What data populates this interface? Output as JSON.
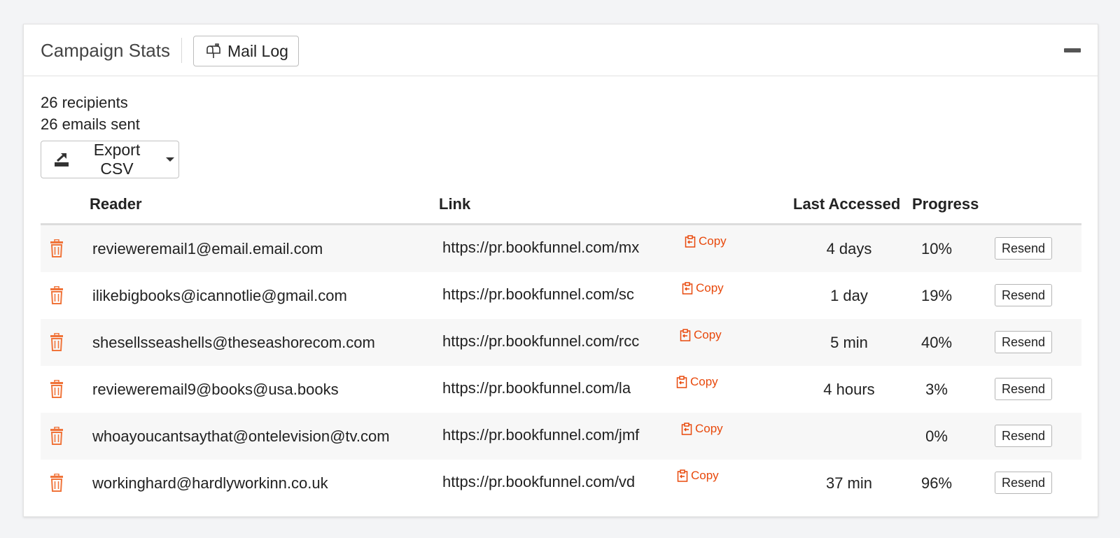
{
  "header": {
    "title": "Campaign Stats",
    "mail_log_label": "Mail Log"
  },
  "summary": {
    "recipients": "26 recipients",
    "emails_sent": "26 emails sent"
  },
  "export": {
    "label": "Export CSV"
  },
  "table": {
    "columns": [
      "Reader",
      "Link",
      "Last Accessed",
      "Progress"
    ],
    "copy_label": "Copy",
    "resend_label": "Resend",
    "rows": [
      {
        "reader": "revieweremail1@email.email.com",
        "link": "https://pr.bookfunnel.com/mx",
        "last_accessed": "4 days",
        "progress": "10%"
      },
      {
        "reader": "ilikebigbooks@icannotlie@gmail.com",
        "link": "https://pr.bookfunnel.com/sc",
        "last_accessed": "1 day",
        "progress": "19%"
      },
      {
        "reader": "shesellsseashells@theseashorecom.com",
        "link": "https://pr.bookfunnel.com/rcc",
        "last_accessed": "5 min",
        "progress": "40%"
      },
      {
        "reader": "revieweremail9@books@usa.books",
        "link": "https://pr.bookfunnel.com/la",
        "last_accessed": "4 hours",
        "progress": "3%"
      },
      {
        "reader": "whoayoucantsaythat@ontelevision@tv.com",
        "link": "https://pr.bookfunnel.com/jmf",
        "last_accessed": "",
        "progress": "0%"
      },
      {
        "reader": "workinghard@hardlyworkinn.co.uk",
        "link": "https://pr.bookfunnel.com/vd",
        "last_accessed": "37 min",
        "progress": "96%"
      }
    ]
  },
  "colors": {
    "accent": "#e8480b",
    "trash": "#f0743a",
    "stripe": "#f7f7f7"
  }
}
